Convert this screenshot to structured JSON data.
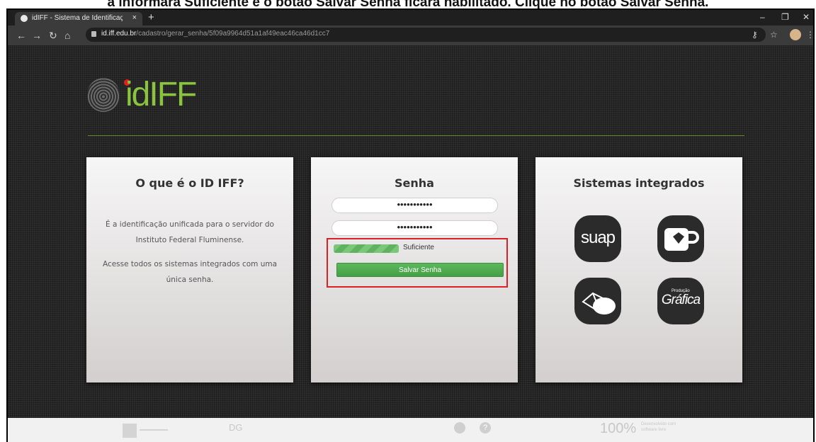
{
  "caption": "a informará Suficiente e o botão Salvar Senha ficará habilitado. Clique no botão Salvar Senha.",
  "browser": {
    "tab_title": "idIFF - Sistema de Identificação Ú",
    "tab_close": "×",
    "new_tab": "+",
    "url_host": "id.iff.edu.br",
    "url_path": "/cadastro/gerar_senha/5f09a9964d51a1af49eac46ca46d1cc7",
    "win_min": "–",
    "win_restore": "❐",
    "win_close": "✕"
  },
  "logo": {
    "text": "idIFF"
  },
  "cards": {
    "about": {
      "title": "O que é o ID IFF?",
      "p1": "É a identificação unificada para o servidor do Instituto Federal Fluminense.",
      "p2": "Acesse todos os sistemas integrados com uma única senha."
    },
    "password": {
      "title": "Senha",
      "field1_value": "•••••••••••",
      "field2_value": "•••••••••••",
      "strength_label": "Suficiente",
      "strength_level": 1.0,
      "save_button": "Salvar Senha"
    },
    "systems": {
      "title": "Sistemas integrados",
      "suap": "suap",
      "grafica": "Gráfica",
      "grafica_small": "Produção"
    }
  },
  "footer": {
    "dg": "DG",
    "percent": "100%",
    "dev_line1": "Desenvolvido com",
    "dev_line2": "software livre"
  },
  "colors": {
    "accent_green": "#8ac33f",
    "button_green": "#5cb85c",
    "highlight_red": "#d92127"
  }
}
